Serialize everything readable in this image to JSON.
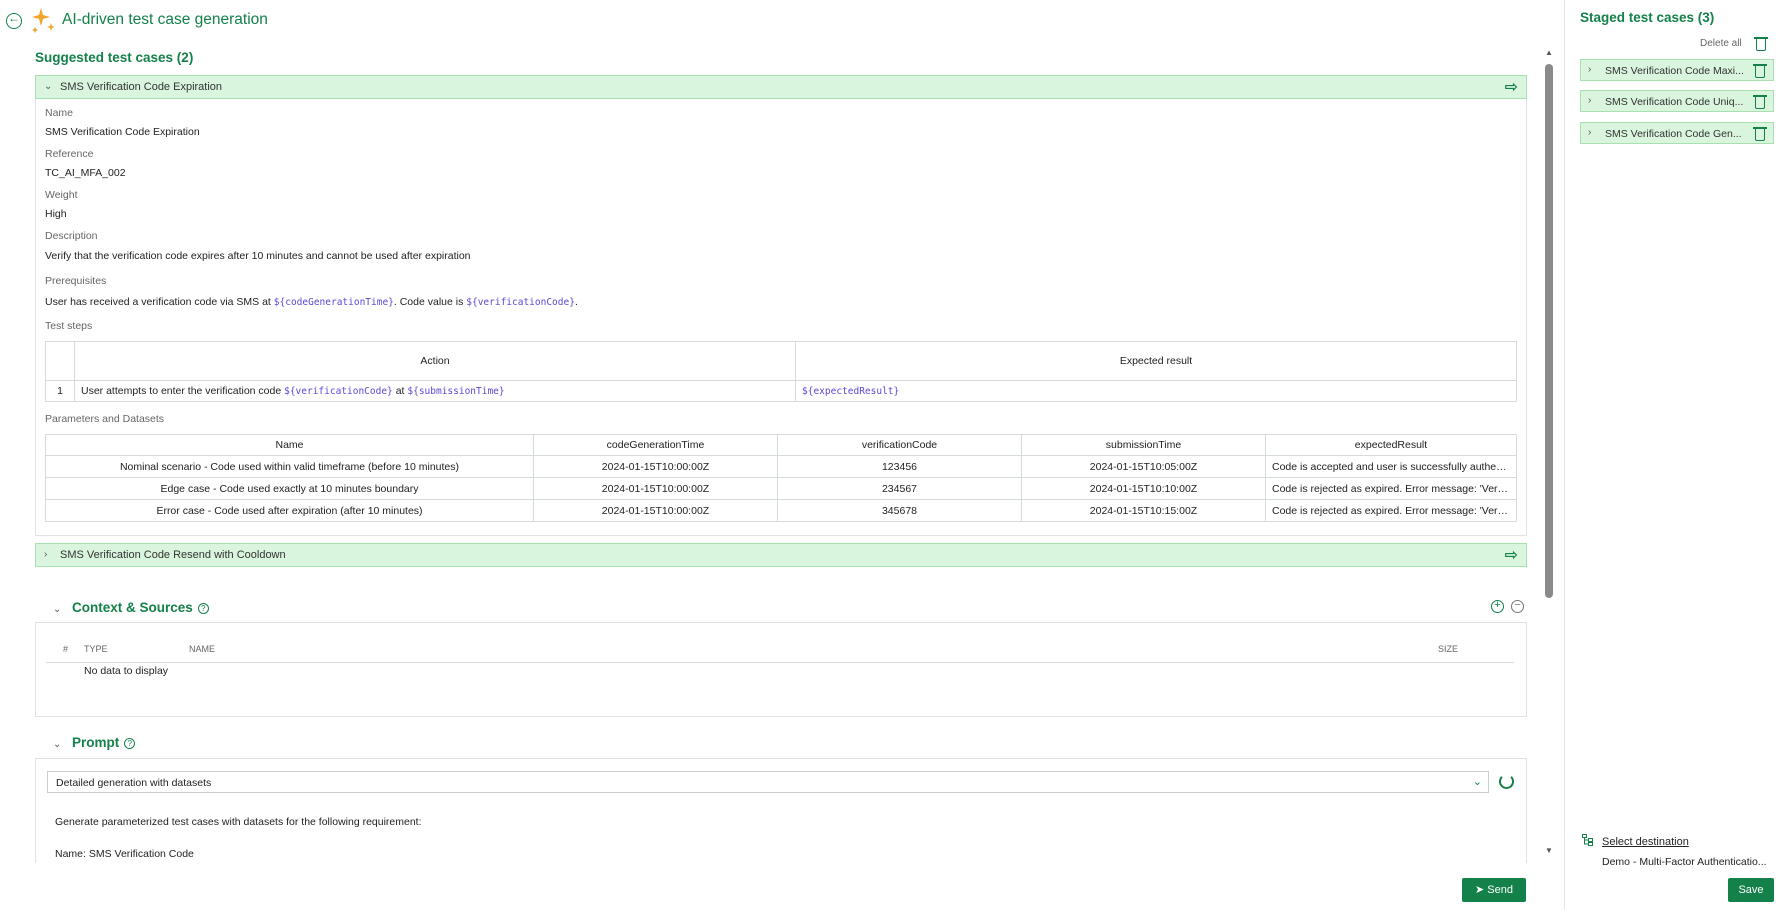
{
  "header": {
    "title": "AI-driven test case generation"
  },
  "suggested": {
    "title": "Suggested test cases (2)",
    "case1": {
      "title": "SMS Verification Code Expiration",
      "name_label": "Name",
      "name": "SMS Verification Code Expiration",
      "reference_label": "Reference",
      "reference": "TC_AI_MFA_002",
      "weight_label": "Weight",
      "weight": "High",
      "description_label": "Description",
      "description": "Verify that the verification code expires after 10 minutes and cannot be used after expiration",
      "prerequisites_label": "Prerequisites",
      "prereq_text1": "User has received a verification code via SMS at ",
      "prereq_var1": "${codeGenerationTime}",
      "prereq_text2": ". Code value is ",
      "prereq_var2": "${verificationCode}",
      "prereq_text3": ".",
      "steps_label": "Test steps",
      "steps_headers": {
        "action": "Action",
        "expected": "Expected result"
      },
      "step1": {
        "num": "1",
        "action_text": "User attempts to enter the verification code ",
        "action_var1": "${verificationCode}",
        "action_mid": " at ",
        "action_var2": "${submissionTime}",
        "expected_var": "${expectedResult}"
      },
      "params_label": "Parameters and Datasets",
      "params_headers": [
        "Name",
        "codeGenerationTime",
        "verificationCode",
        "submissionTime",
        "expectedResult"
      ],
      "params_rows": [
        [
          "Nominal scenario - Code used within valid timeframe (before 10 minutes)",
          "2024-01-15T10:00:00Z",
          "123456",
          "2024-01-15T10:05:00Z",
          "Code is accepted and user is successfully authen..."
        ],
        [
          "Edge case - Code used exactly at 10 minutes boundary",
          "2024-01-15T10:00:00Z",
          "234567",
          "2024-01-15T10:10:00Z",
          "Code is rejected as expired. Error message: 'Verif..."
        ],
        [
          "Error case - Code used after expiration (after 10 minutes)",
          "2024-01-15T10:00:00Z",
          "345678",
          "2024-01-15T10:15:00Z",
          "Code is rejected as expired. Error message: 'Verif..."
        ]
      ]
    },
    "case2": {
      "title": "SMS Verification Code Resend with Cooldown"
    }
  },
  "context": {
    "title": "Context & Sources",
    "columns": {
      "num": "#",
      "type": "TYPE",
      "name": "NAME",
      "size": "SIZE"
    },
    "empty": "No data to display"
  },
  "prompt": {
    "title": "Prompt",
    "selected": "Detailed generation with datasets",
    "line1": "Generate parameterized test cases with datasets for the following requirement:",
    "line2": "Name: SMS Verification Code"
  },
  "send_label": "Send",
  "staged": {
    "title": "Staged test cases (3)",
    "delete_all": "Delete all",
    "items": [
      "SMS Verification Code Maxi...",
      "SMS Verification Code Uniq...",
      "SMS Verification Code Gen..."
    ],
    "select_destination": "Select destination",
    "destination": "Demo - Multi-Factor Authenticatio...",
    "save_label": "Save"
  },
  "colors": {
    "accent": "#14804a",
    "highlight": "#d9f5dd"
  }
}
